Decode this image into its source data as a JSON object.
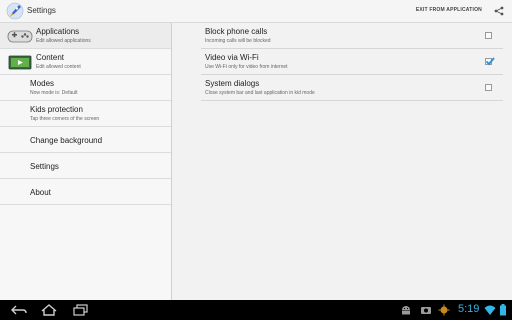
{
  "actionbar": {
    "title": "Settings",
    "exit_label": "EXIT FROM APPLICATION"
  },
  "nav": [
    {
      "id": "applications",
      "title": "Applications",
      "subtitle": "Edit allowed applications",
      "icon": "gamepad-icon"
    },
    {
      "id": "content",
      "title": "Content",
      "subtitle": "Edit allowed content",
      "icon": "video-icon"
    },
    {
      "id": "modes",
      "title": "Modes",
      "subtitle": "Now mode is: Default"
    },
    {
      "id": "kids-protection",
      "title": "Kids protection",
      "subtitle": "Tap three corners of the screen"
    },
    {
      "id": "change-background",
      "title": "Change background"
    },
    {
      "id": "settings",
      "title": "Settings"
    },
    {
      "id": "about",
      "title": "About"
    }
  ],
  "settings": [
    {
      "title": "Block phone calls",
      "subtitle": "Incoming calls will be blocked",
      "checked": false
    },
    {
      "title": "Video via Wi-Fi",
      "subtitle": "Use Wi-Fi only for video from internet",
      "checked": true
    },
    {
      "title": "System dialogs",
      "subtitle": "Close system bar and last application in kid mode",
      "checked": false
    }
  ],
  "systembar": {
    "time": "5:19",
    "icons": [
      "back-icon",
      "home-icon",
      "recents-icon",
      "android-icon",
      "camera-icon",
      "debug-icon",
      "wifi-icon",
      "battery-icon"
    ]
  },
  "colors": {
    "accent": "#33b5e5",
    "checkbox": "#2c8ed6"
  }
}
